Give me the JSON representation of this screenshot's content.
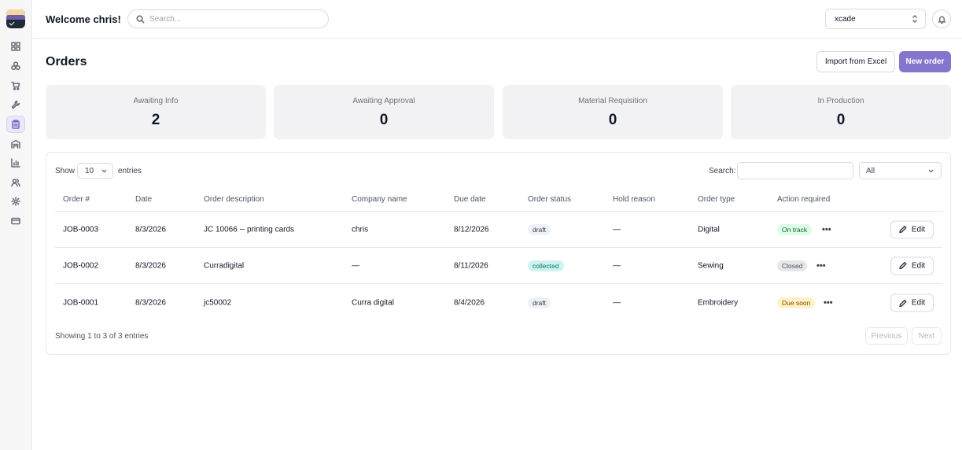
{
  "sidebar": {
    "items": [
      {
        "icon": "dashboard-icon",
        "active": false
      },
      {
        "icon": "products-icon",
        "active": false
      },
      {
        "icon": "cart-icon",
        "active": false
      },
      {
        "icon": "wrench-icon",
        "active": false
      },
      {
        "icon": "clipboard-icon",
        "active": true
      },
      {
        "icon": "warehouse-icon",
        "active": false
      },
      {
        "icon": "chart-icon",
        "active": false
      },
      {
        "icon": "users-icon",
        "active": false
      },
      {
        "icon": "gear-icon",
        "active": false
      },
      {
        "icon": "credit-card-icon",
        "active": false
      }
    ]
  },
  "header": {
    "welcome": "Welcome chris!",
    "search_placeholder": "Search...",
    "org": "xcade"
  },
  "page": {
    "title": "Orders",
    "import_label": "Import from Excel",
    "new_label": "New order"
  },
  "stats": [
    {
      "label": "Awaiting Info",
      "value": "2"
    },
    {
      "label": "Awaiting Approval",
      "value": "0"
    },
    {
      "label": "Material Requisition",
      "value": "0"
    },
    {
      "label": "In Production",
      "value": "0"
    }
  ],
  "table": {
    "show_label": "Show",
    "entries_value": "10",
    "entries_label": "entries",
    "search_label": "Search:",
    "filter_value": "All",
    "columns": [
      "Order #",
      "Date",
      "Order description",
      "Company name",
      "Due date",
      "Order status",
      "Hold reason",
      "Order type",
      "Action required"
    ],
    "rows": [
      {
        "order": "JOB-0003",
        "date": "8/3/2026",
        "description": "JC 10066 -- printing cards",
        "company": "chris",
        "due": "8/12/2026",
        "status": "draft",
        "hold": "—",
        "type": "Digital",
        "action": "On track",
        "more": "•••",
        "edit": "Edit"
      },
      {
        "order": "JOB-0002",
        "date": "8/3/2026",
        "description": "Curradigital",
        "company": "—",
        "due": "8/11/2026",
        "status": "collected",
        "hold": "—",
        "type": "Sewing",
        "action": "Closed",
        "more": "•••",
        "edit": "Edit"
      },
      {
        "order": "JOB-0001",
        "date": "8/3/2026",
        "description": "jc50002",
        "company": "Curra digital",
        "due": "8/4/2026",
        "status": "draft",
        "hold": "—",
        "type": "Embroidery",
        "action": "Due soon",
        "more": "•••",
        "edit": "Edit"
      }
    ],
    "showing": "Showing 1 to 3 of 3 entries",
    "previous": "Previous",
    "next": "Next"
  },
  "colors": {
    "accent": "#8675cc",
    "on_track": "#dcfce7",
    "due_soon": "#fef3c7",
    "collected": "#ccf3ee"
  }
}
